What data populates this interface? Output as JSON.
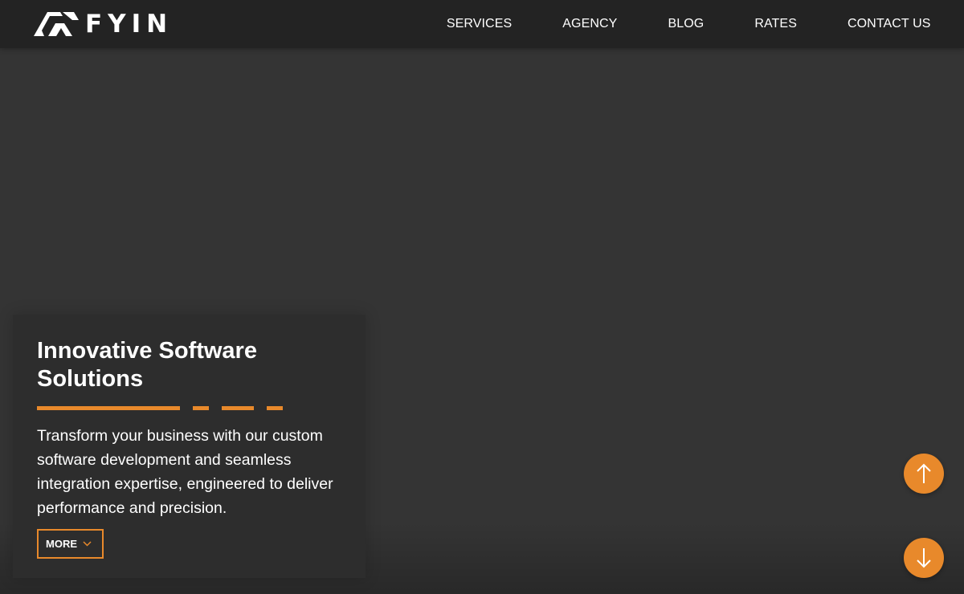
{
  "colors": {
    "accent": "#e8892b",
    "header_bg": "#232323",
    "page_bg": "#343434",
    "card_bg": "#2d2d2d",
    "text": "#ffffff"
  },
  "header": {
    "logo_text": "FYIN",
    "nav": [
      {
        "label": "SERVICES"
      },
      {
        "label": "AGENCY"
      },
      {
        "label": "BLOG"
      },
      {
        "label": "RATES"
      },
      {
        "label": "CONTACT US"
      }
    ]
  },
  "hero": {
    "title": "Innovative Software Solutions",
    "description": "Transform your business with our custom software development and seamless integration expertise, engineered to deliver performance and precision.",
    "more_label": "MORE",
    "more_icon": "chevron-down-icon"
  },
  "controls": {
    "scroll_up_icon": "arrow-up-icon",
    "scroll_down_icon": "arrow-down-icon"
  }
}
